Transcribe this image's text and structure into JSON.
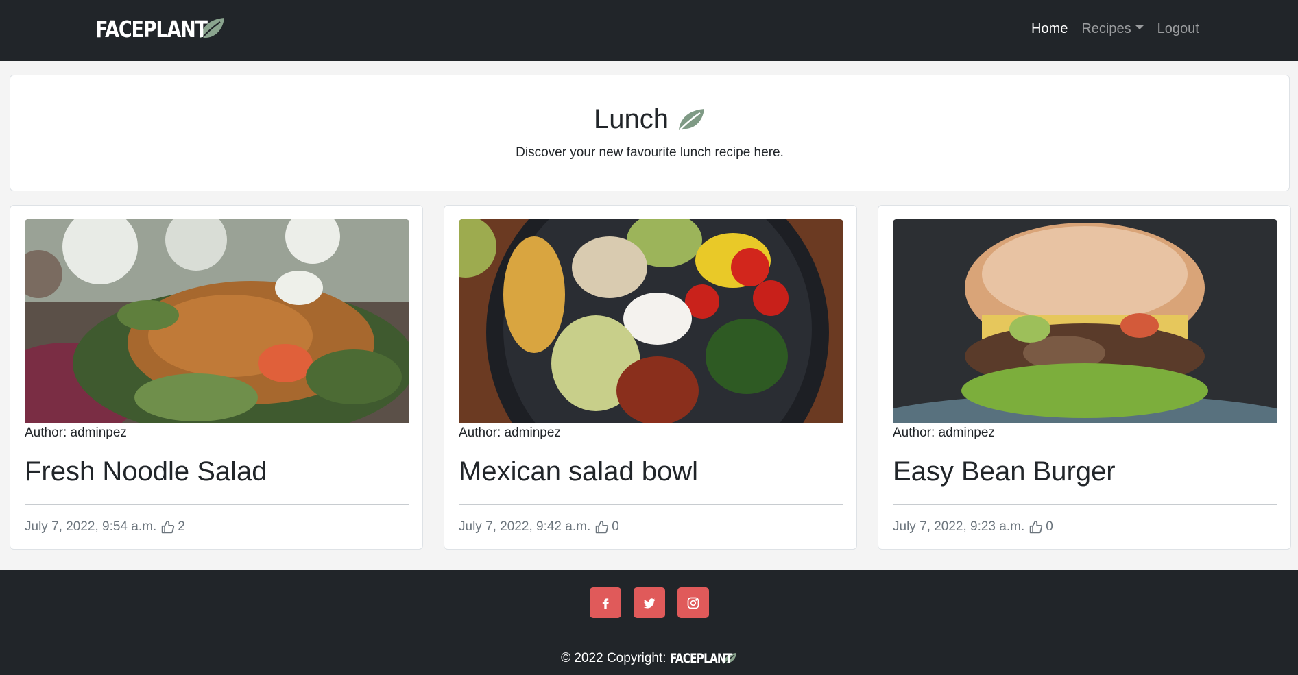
{
  "nav": {
    "brand": "FACEPLANT",
    "links": [
      {
        "label": "Home"
      },
      {
        "label": "Recipes"
      },
      {
        "label": "Logout"
      }
    ]
  },
  "hero": {
    "title": "Lunch",
    "subtitle": "Discover your new favourite lunch recipe here."
  },
  "cards": [
    {
      "author": "Author: adminpez",
      "title": "Fresh Noodle Salad",
      "date": "July 7, 2022, 9:54 a.m.",
      "likes": "2",
      "image": "noodle-salad-photo"
    },
    {
      "author": "Author: adminpez",
      "title": "Mexican salad bowl",
      "date": "July 7, 2022, 9:42 a.m.",
      "likes": "0",
      "image": "mexican-bowl-photo"
    },
    {
      "author": "Author: adminpez",
      "title": "Easy Bean Burger",
      "date": "July 7, 2022, 9:23 a.m.",
      "likes": "0",
      "image": "bean-burger-photo"
    }
  ],
  "footer": {
    "social": [
      "facebook-icon",
      "twitter-icon",
      "instagram-icon"
    ],
    "copyright": "© 2022 Copyright:",
    "brand": "FACEPLANT"
  },
  "colors": {
    "nav_bg": "#212529",
    "page_bg": "#f4f4f4",
    "accent_red": "#e05a5a",
    "leaf_green": "#8aa48e"
  }
}
